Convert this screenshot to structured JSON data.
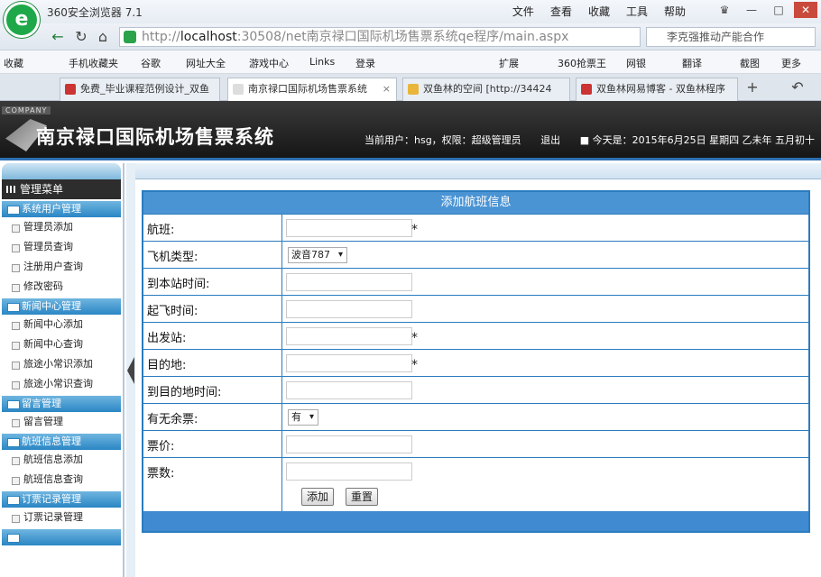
{
  "browser": {
    "app_title": "360安全浏览器 7.1",
    "menu": [
      "文件",
      "查看",
      "收藏",
      "工具",
      "帮助"
    ],
    "address": {
      "scheme": "http://",
      "host": "localhost",
      "rest": ":30508/net南京禄口国际机场售票系统qe程序/main.aspx"
    },
    "search_text": "李克强推动产能合作",
    "favorites": [
      "收藏",
      "手机收藏夹",
      "谷歌",
      "网址大全",
      "游戏中心",
      "Links",
      "登录",
      "扩展",
      "360抢票王",
      "网银",
      "翻译",
      "截图",
      "更多"
    ],
    "tabs": [
      "免费_毕业课程范例设计_双鱼",
      "南京禄口国际机场售票系统",
      "双鱼林的空间 [http://34424",
      "双鱼林网易博客 - 双鱼林程序"
    ]
  },
  "header": {
    "company": "COMPANY",
    "system_name": "南京禄口国际机场售票系统",
    "user_info": "当前用户：hsg，权限：超级管理员",
    "logout": "退出",
    "date": "■ 今天是：2015年6月25日 星期四 乙未年 五月初十"
  },
  "sidebar": {
    "title": "管理菜单",
    "groups": [
      {
        "label": "系统用户管理",
        "items": [
          "管理员添加",
          "管理员查询",
          "注册用户查询",
          "修改密码"
        ]
      },
      {
        "label": "新闻中心管理",
        "items": [
          "新闻中心添加",
          "新闻中心查询",
          "旅途小常识添加",
          "旅途小常识查询"
        ]
      },
      {
        "label": "留言管理",
        "items": [
          "留言管理"
        ]
      },
      {
        "label": "航班信息管理",
        "items": [
          "航班信息添加",
          "航班信息查询"
        ]
      },
      {
        "label": "订票记录管理",
        "items": [
          "订票记录管理"
        ]
      }
    ]
  },
  "form": {
    "title": "添加航班信息",
    "fields": [
      {
        "label": "航班:",
        "required": "*"
      },
      {
        "label": "飞机类型:",
        "select": "波音787"
      },
      {
        "label": "到本站时间:"
      },
      {
        "label": "起飞时间:"
      },
      {
        "label": "出发站:",
        "required": "*"
      },
      {
        "label": "目的地:",
        "required": "*"
      },
      {
        "label": "到目的地时间:"
      },
      {
        "label": "有无余票:",
        "select": "有"
      },
      {
        "label": "票价:"
      },
      {
        "label": "票数:"
      }
    ],
    "submit": "添加",
    "reset": "重置"
  }
}
